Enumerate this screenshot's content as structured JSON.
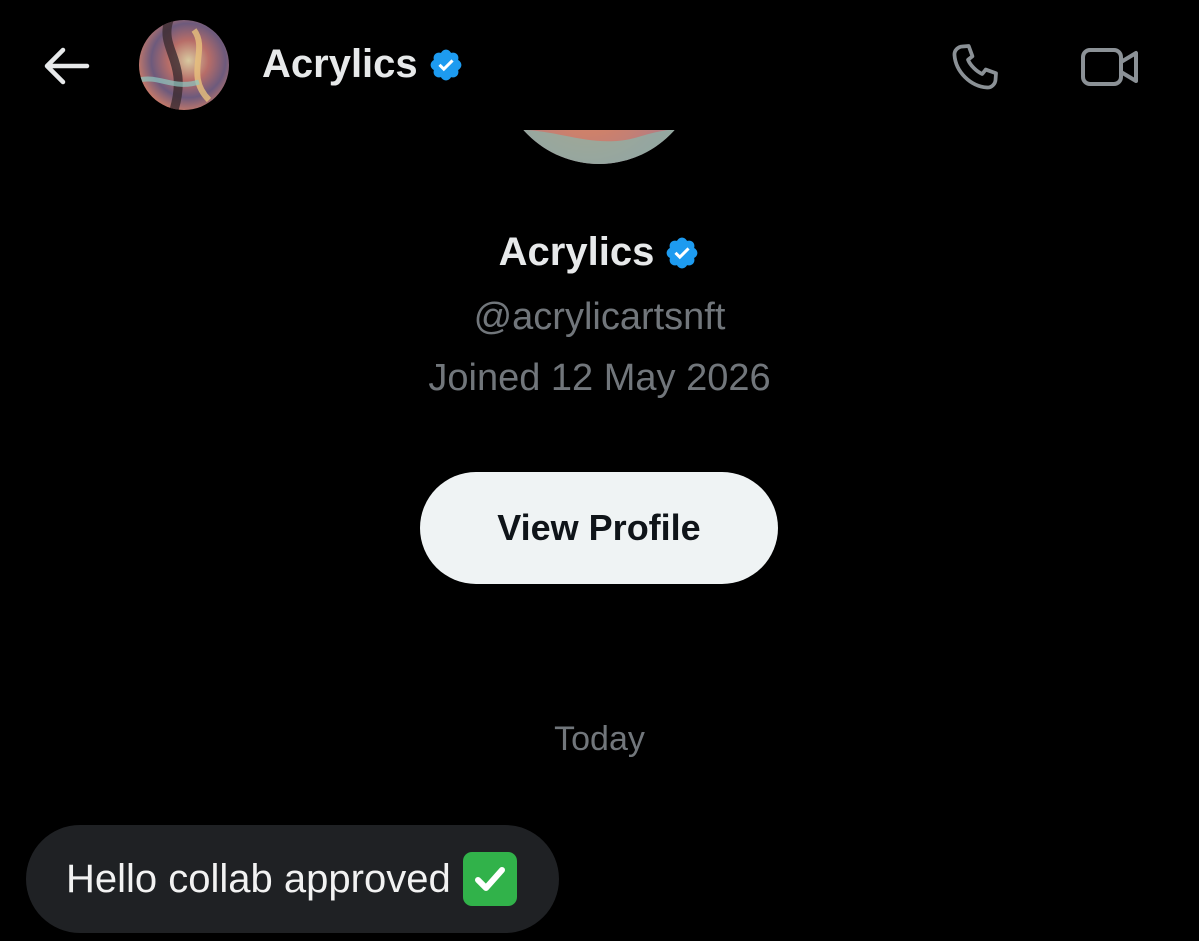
{
  "header": {
    "back_icon": "arrow-left-icon",
    "title": "Acrylics",
    "verified_icon": "verified-badge-icon",
    "call_icon": "phone-icon",
    "video_icon": "video-camera-icon"
  },
  "profile": {
    "name": "Acrylics",
    "handle": "@acrylicartsnft",
    "joined": "Joined 12 May 2026",
    "view_profile_label": "View Profile"
  },
  "conversation": {
    "date_divider": "Today",
    "messages": [
      {
        "text": "Hello collab approved",
        "emoji_icon": "check-mark-button-icon"
      }
    ]
  },
  "colors": {
    "background": "#000000",
    "verified": "#1d9bf0",
    "muted_text": "#71767b",
    "primary_text": "#e7e9ea",
    "button_bg": "#eff3f4",
    "bubble_bg": "#1f2124",
    "emoji_green": "#31b24a"
  }
}
